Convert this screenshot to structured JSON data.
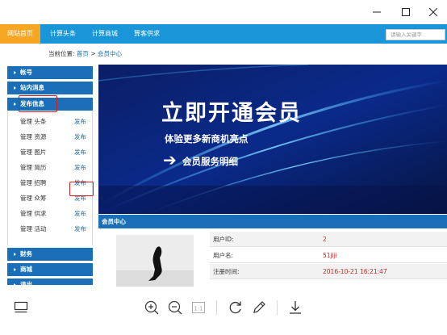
{
  "window": {
    "buttons": {
      "minimize": "minimize",
      "maximize": "maximize",
      "close": "close"
    }
  },
  "site": {
    "nav": [
      {
        "label": "网站首页",
        "active": true
      },
      {
        "label": "计算头条",
        "active": false
      },
      {
        "label": "计算商城",
        "active": false
      },
      {
        "label": "算客供求",
        "active": false
      }
    ],
    "search_placeholder": "请输入关键字",
    "breadcrumb": {
      "prefix": "当前位置:",
      "home": "首页",
      "sep": ">",
      "current": "会员中心"
    }
  },
  "sidebar": {
    "sections": [
      {
        "label": "帐号"
      },
      {
        "label": "站内消息"
      },
      {
        "label": "发布信息"
      }
    ],
    "items": [
      {
        "name": "管理 头条",
        "action": "发布"
      },
      {
        "name": "管理 资源",
        "action": "发布"
      },
      {
        "name": "管理 图片",
        "action": "发布"
      },
      {
        "name": "管理 简历",
        "action": "发布"
      },
      {
        "name": "管理 招聘",
        "action": "发布"
      },
      {
        "name": "管理 众筹",
        "action": "发布"
      },
      {
        "name": "管理 供求",
        "action": "发布"
      },
      {
        "name": "管理 活动",
        "action": "发布"
      }
    ],
    "bottom_sections": [
      {
        "label": "财务"
      },
      {
        "label": "商城"
      },
      {
        "label": "退出"
      }
    ]
  },
  "banner": {
    "title": "立即开通会员",
    "subtitle": "体验更多新商机亮点",
    "arrow": "➔",
    "link": "会员服务明细"
  },
  "member": {
    "heading": "会员中心",
    "fields": [
      {
        "key": "用户ID:",
        "value": "2"
      },
      {
        "key": "用户名:",
        "value": "51jiji"
      },
      {
        "key": "注册时间:",
        "value": "2016-10-21 16:21:47"
      }
    ]
  },
  "toolbar": {
    "icons": [
      "filmstrip-icon",
      "zoom-in-icon",
      "zoom-out-icon",
      "actual-size-icon",
      "rotate-icon",
      "edit-pen-icon",
      "download-icon"
    ],
    "actual_size_label": "1:1"
  },
  "colors": {
    "nav_blue": "#1a95d8",
    "nav_active": "#f5a623",
    "section_blue": "#1a6fb8",
    "highlight_red": "#d42020"
  }
}
